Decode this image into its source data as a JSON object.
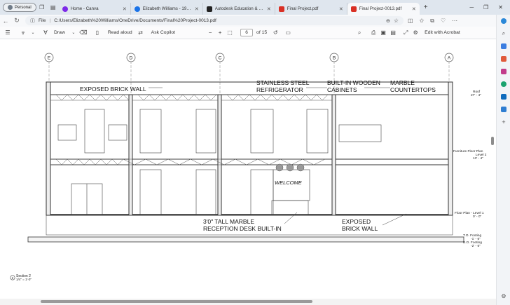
{
  "browser": {
    "profile_label": "Personal",
    "tabs": [
      {
        "title": "Home - Canva",
        "color": "#7d2ae8",
        "active": false
      },
      {
        "title": "Elizabeth Williams - 19.999 =",
        "color": "#1a73e8",
        "active": false
      },
      {
        "title": "Autodesk Education & Student",
        "color": "#222222",
        "active": false
      },
      {
        "title": "Final Project.pdf",
        "color": "#d93025",
        "active": false
      },
      {
        "title": "Final Project-0013.pdf",
        "color": "#d93025",
        "active": true
      }
    ],
    "address": {
      "scheme_label": "File",
      "url": "C:/Users/Elizabeth%20Williams/OneDrive/Documents/Final%20Project-0013.pdf"
    }
  },
  "pdf_toolbar": {
    "draw_label": "Draw",
    "read_aloud_label": "Read aloud",
    "ask_copilot_label": "Ask Copilot",
    "page_number": "6",
    "page_total": "of 15",
    "edit_label": "Edit with Acrobat"
  },
  "drawing": {
    "grid_labels": [
      "E",
      "D",
      "C",
      "B",
      "A"
    ],
    "callouts": {
      "exposed_brick_top": "EXPOSED BRICK WALL",
      "stainless_1": "STAINLESS STEEL",
      "stainless_2": "REFRIGERATOR",
      "built_in_1": "BUILT-IN WOODEN",
      "built_in_2": "CABINETS",
      "marble_1": "MARBLE",
      "marble_2": "COUNTERTOPS",
      "reception_1": "3'0\" TALL MARBLE",
      "reception_2": "RECEPTION DESK BUILT-IN",
      "exposed_brick_bottom_1": "EXPOSED",
      "exposed_brick_bottom_2": "BRICK WALL",
      "welcome_sign": "WELCOME"
    },
    "levels": {
      "roof_1": "Roof",
      "roof_2": "27' - 4\"",
      "furniture_1": "Furniture Floor Plan",
      "furniture_2": "Level 2",
      "furniture_3": "13' - 4\"",
      "level1_1": "Floor Plan - Level 1",
      "level1_2": "0' - 0\"",
      "to_footing_1": "T.O. Footing",
      "to_footing_2": "-1' - 6\"",
      "bo_footing_1": "B.O. Footing",
      "bo_footing_2": "-2' - 6\""
    },
    "section_label_1": "Section 2",
    "section_label_2": "1/4\" = 1'-0\"",
    "section_marker": "2"
  }
}
